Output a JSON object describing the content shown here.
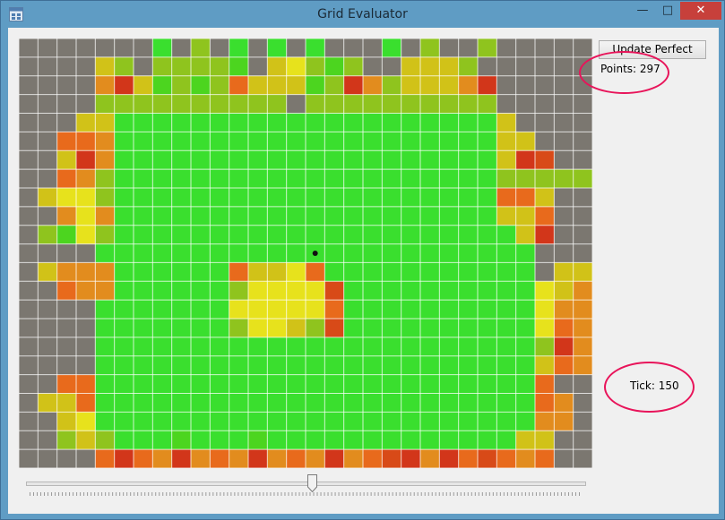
{
  "window": {
    "title": "Grid Evaluator",
    "minimize_label": "—",
    "maximize_label": "□",
    "close_label": "✕"
  },
  "controls": {
    "update_button_label": "Update Perfect",
    "points_text": "Points: 297",
    "tick_text": "Tick: 150"
  },
  "slider": {
    "value_fraction": 0.52
  },
  "marker": {
    "col": 15,
    "row": 11
  },
  "palette": {
    "G": "#3adf2e",
    "g": "#4cd51f",
    "L": "#8fc41e",
    "y": "#d1c218",
    "Y": "#e7e21c",
    "o": "#e28c1e",
    "O": "#e86a1c",
    "r": "#d84a18",
    "R": "#d2361a",
    "n": "#7b7770",
    "k": "#3f3d3a"
  },
  "grid": {
    "cols": 30,
    "rows": 23,
    "cells": [
      "nnnnnnnGnLnGnGnGnnnGnLnnLnnnnn",
      "nnnnyLnLLLLgnyYLgLnnyyyLnnnnnn",
      "nnnnoRygLgLOyyygLRoLyyyoRnnnnn",
      "nnnnLLLLLLLLLLnLLLLLLLLLLnnnnn",
      "nnnyyGGGGGGGGGGGGGGGGGGGGynnnn",
      "nnOOoGGGGGGGGGGGGGGGGGGGGyynnn",
      "nnyRoGGGGGGGGGGGGGGGGGGGGyRrnn",
      "nnOoLGGGGGGGGGGGGGGGGGGGGLLLLL",
      "nyYYLGGGGGGGGGGGGGGGGGGGGOOynn",
      "nnoYoGGGGGGGGGGGGGGGGGGGGyyOnn",
      "nLgYLGGGGGGGGGGGGGGGGGGGGGyRnn",
      "nnnnGGGGGGGGGGGGGGGGGGGGGGGnnn",
      "nyoooGGGGGGOyyYOGGGGGGGGGGGnyy",
      "nnOooGGGGGGLYYYYrGGGGGGGGGGYyo",
      "nnnnGGGGGGGYYYYYOGGGGGGGGGGYoo",
      "nnnnGGGGGGGLYYyLrGGGGGGGGGGYOo",
      "nnnnGGGGGGGGGGGGGGGGGGGGGGGLRo",
      "nnnnGGGGGGGGGGGGGGGGGGGGGGGyOo",
      "nnOOGGGGGGGGGGGGGGGGGGGGGGGOnn",
      "nyyOGGGGGGGGGGGGGGGGGGGGGGGOon",
      "nnyYGGGGGGGGGGGGGGGGGGGGGGGoon",
      "nnLyLGGGgGGGgGGGGGGGGGGGGGyynn",
      "nnnnOROoRoOoRoOoRoOrRoROrOoOnn"
    ]
  }
}
